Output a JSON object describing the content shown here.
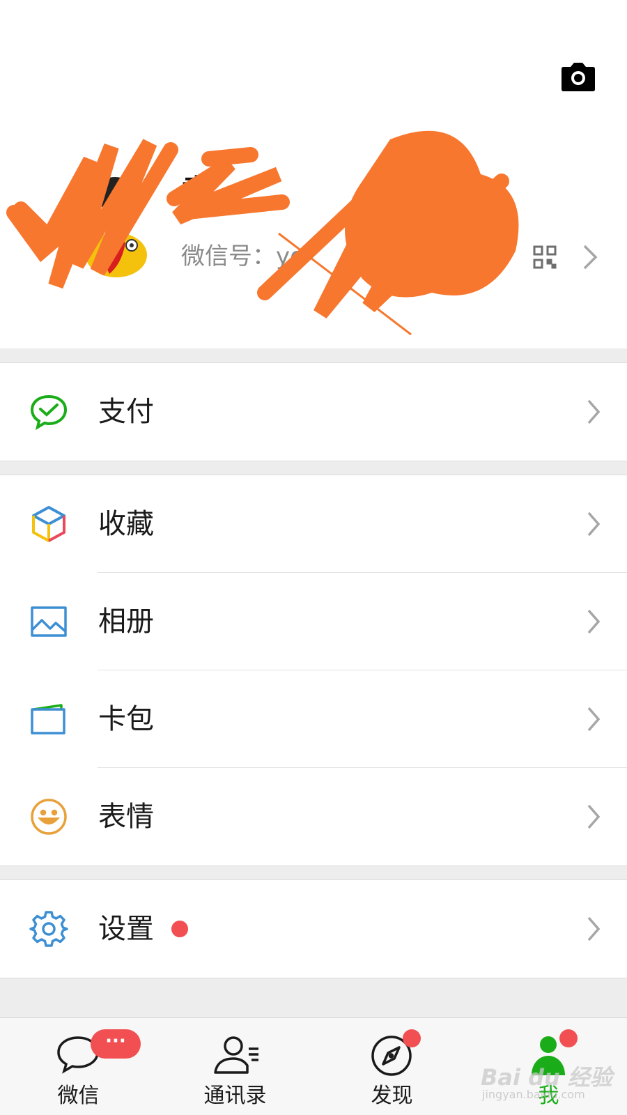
{
  "profile": {
    "name": "袁",
    "wechat_id_label": "微信号：",
    "wechat_id_value": "yo"
  },
  "menu": {
    "pay": "支付",
    "favorites": "收藏",
    "album": "相册",
    "card_wallet": "卡包",
    "stickers": "表情",
    "settings": "设置"
  },
  "tabbar": {
    "chats": {
      "label": "微信",
      "badge": "···"
    },
    "contacts": {
      "label": "通讯录"
    },
    "discover": {
      "label": "发现"
    },
    "me": {
      "label": "我"
    }
  },
  "watermark": {
    "text": "Bai du 经验",
    "sub": "jingyan.baidu.com"
  },
  "colors": {
    "accent_green": "#1aad19",
    "badge_red": "#f14f52",
    "icon_blue": "#3d8fd4",
    "icon_orange": "#e8a13a",
    "redaction_orange": "#f7772e"
  }
}
